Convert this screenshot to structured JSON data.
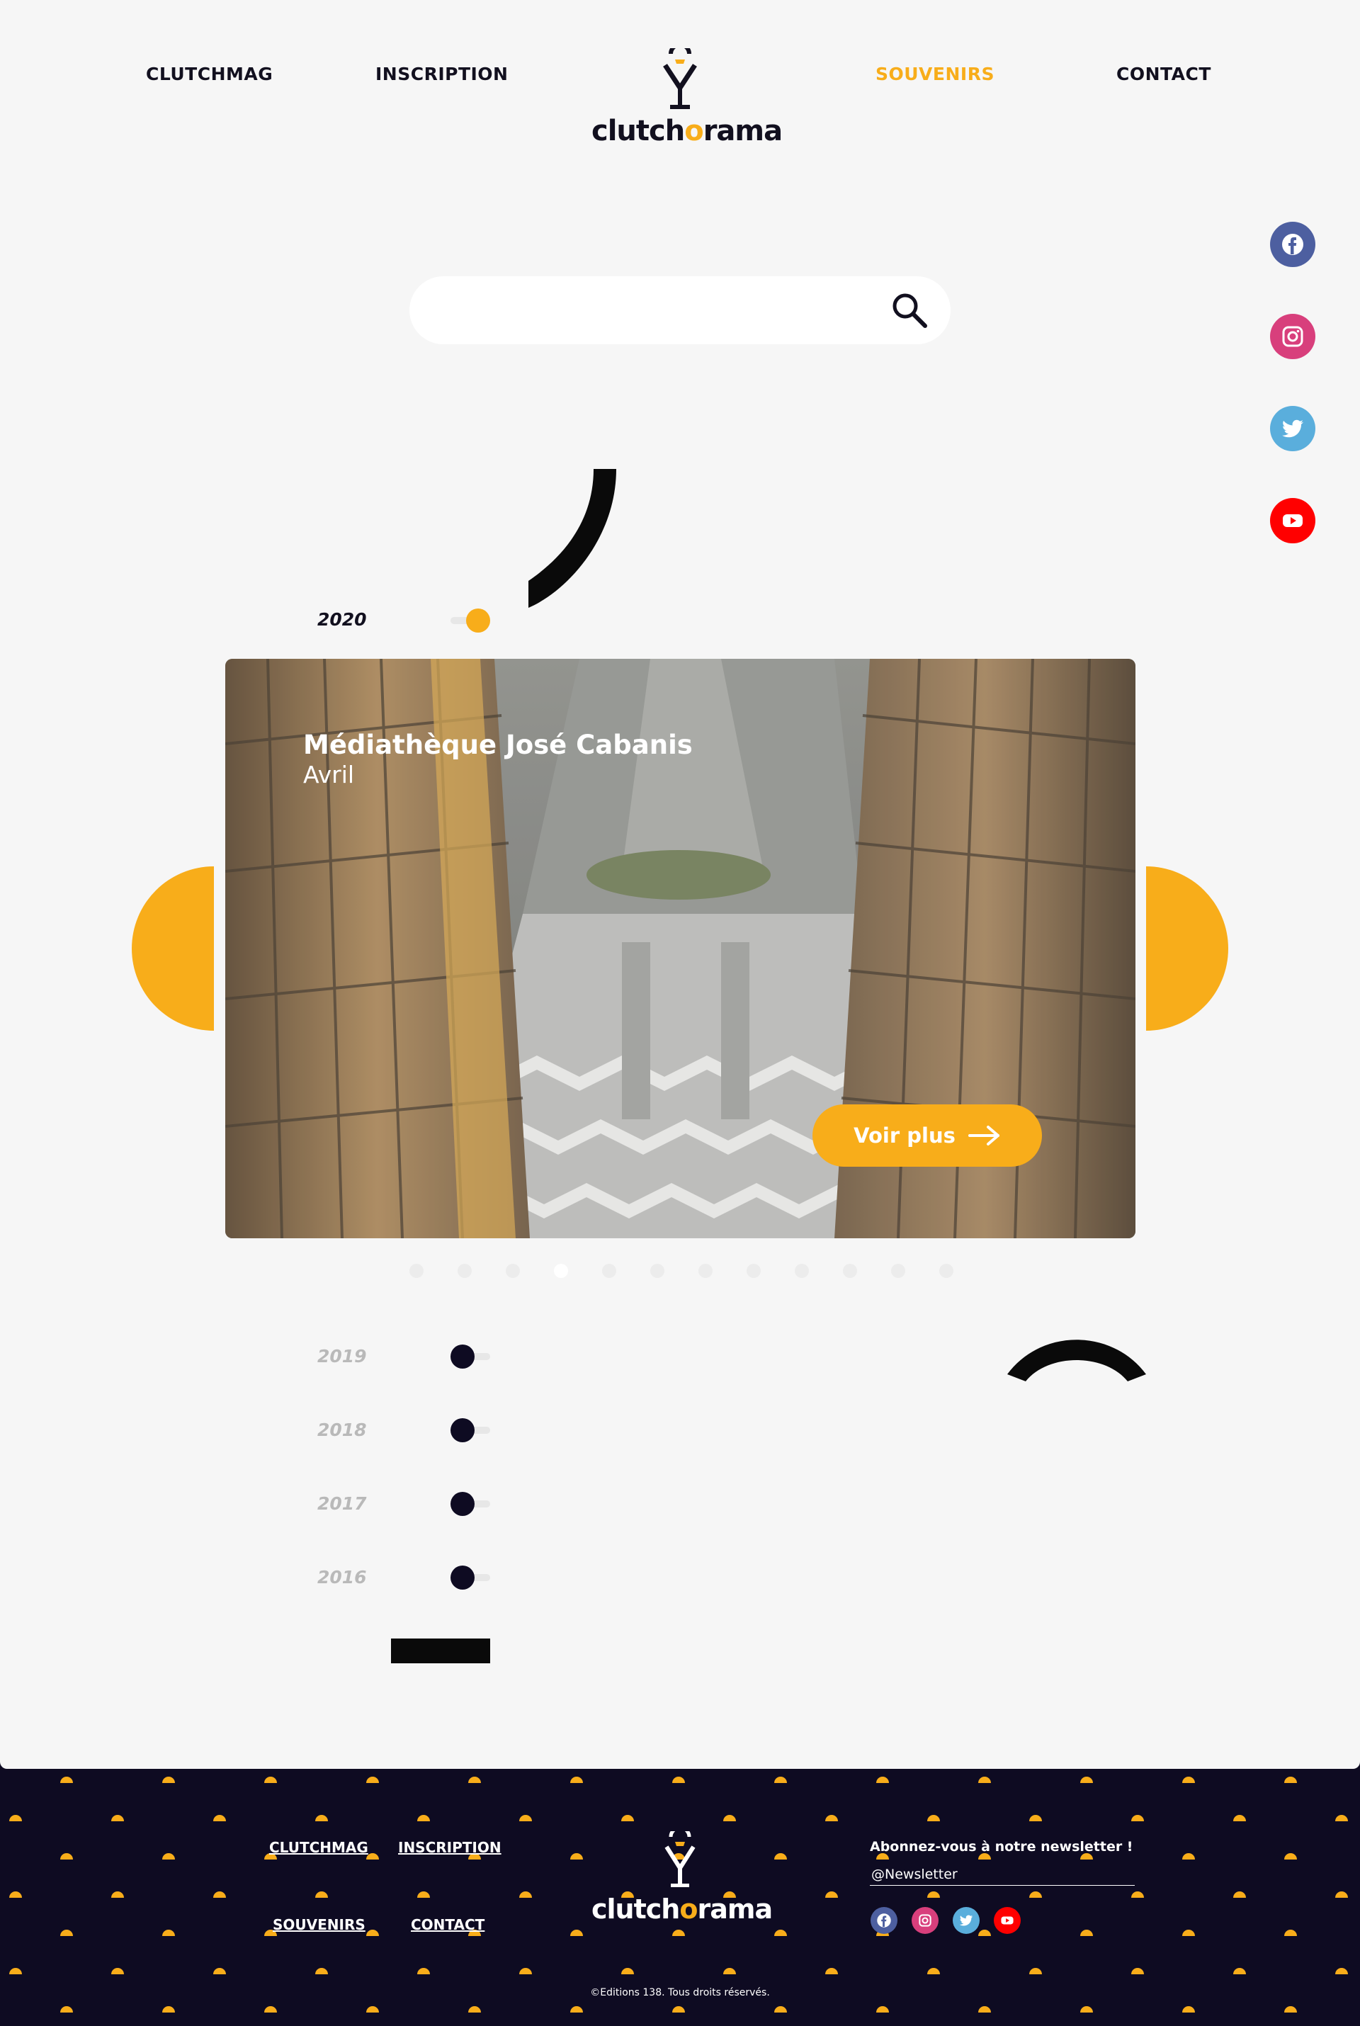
{
  "nav": {
    "links": [
      "CLUTCHMAG",
      "INSCRIPTION",
      "SOUVENIRS",
      "CONTACT"
    ],
    "active": "SOUVENIRS"
  },
  "logo": {
    "text_a": "clutch",
    "text_o": "o",
    "text_b": "rama"
  },
  "search": {
    "placeholder": "",
    "icon": "search-icon"
  },
  "socials": [
    {
      "name": "facebook",
      "color": "#4d5fa0"
    },
    {
      "name": "instagram",
      "color": "#d83f7c"
    },
    {
      "name": "twitter",
      "color": "#5aaedc"
    },
    {
      "name": "youtube",
      "color": "#ff0000"
    }
  ],
  "timeline": {
    "current_year": "2020",
    "past_years": [
      "2019",
      "2018",
      "2017",
      "2016"
    ]
  },
  "card": {
    "title": "Médiathèque José Cabanis",
    "subtitle": "Avril",
    "button": "Voir plus"
  },
  "pager": {
    "count": 12,
    "active_index": 3
  },
  "footer": {
    "links": [
      "CLUTCHMAG",
      "INSCRIPTION",
      "SOUVENIRS",
      "CONTACT"
    ],
    "newsletter_title": "Abonnez-vous à notre newsletter !",
    "newsletter_placeholder": "@Newsletter",
    "copyright": "©Editions 138. Tous droits réservés."
  },
  "colors": {
    "accent": "#f8ad1a",
    "dark": "#12101f",
    "footer_bg": "#0e0b22",
    "page_bg": "#f6f6f6"
  }
}
